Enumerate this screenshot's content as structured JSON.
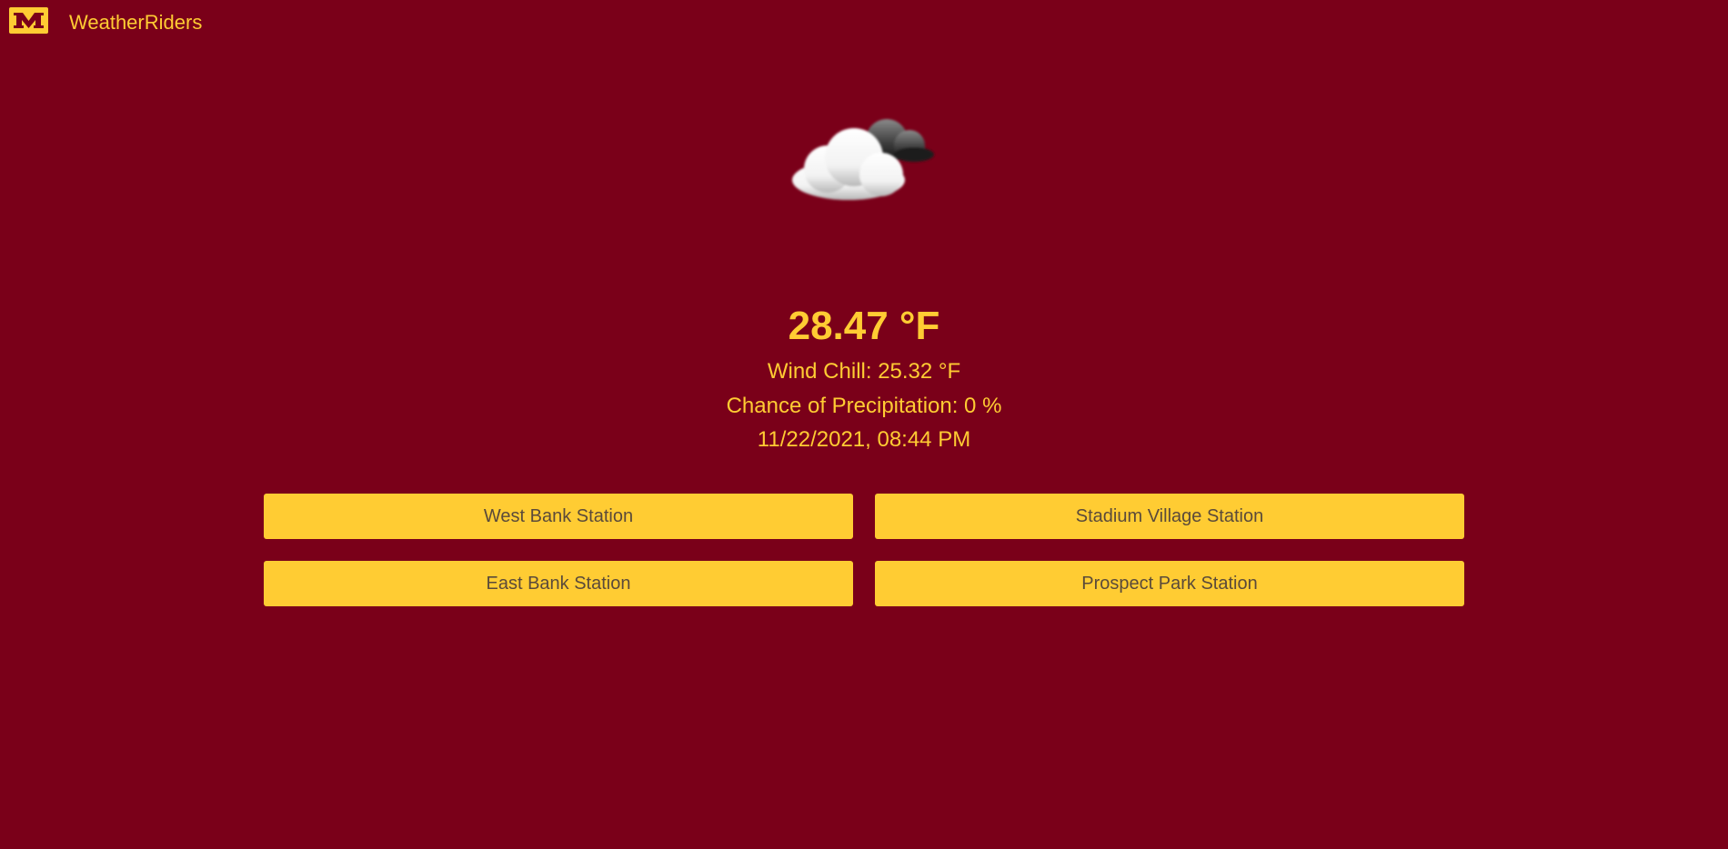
{
  "header": {
    "app_title": "WeatherRiders",
    "logo_icon": "block-m-logo-icon"
  },
  "weather": {
    "icon": "partly-cloudy-icon",
    "temperature": "28.47 °F",
    "wind_chill": "Wind Chill: 25.32 °F",
    "precipitation": "Chance of Precipitation: 0 %",
    "timestamp": "11/22/2021, 08:44 PM"
  },
  "stations": [
    {
      "label": "West Bank Station"
    },
    {
      "label": "Stadium Village Station"
    },
    {
      "label": "East Bank Station"
    },
    {
      "label": "Prospect Park Station"
    }
  ],
  "colors": {
    "background": "#7a0019",
    "accent": "#ffcc33",
    "button_text": "#5a4a3a"
  }
}
